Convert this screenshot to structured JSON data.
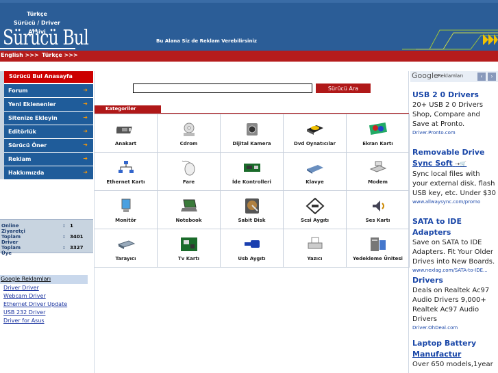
{
  "header": {
    "tagline": [
      "Türkçe",
      "Sürücü / Driver",
      "Arşivi"
    ],
    "logo": "Sürücü Bul",
    "ad_text": "Bu Alana Siz de Reklam Verebilirsiniz",
    "lang_english": "English >>>",
    "lang_turkish": "Türkçe >>>"
  },
  "sidebar": {
    "home": "Sürücü Bul Anasayfa",
    "items": [
      {
        "label": "Forum"
      },
      {
        "label": "Yeni Eklenenler"
      },
      {
        "label": "Sitenize Ekleyin"
      },
      {
        "label": "Editörlük"
      },
      {
        "label": "Sürücü Öner"
      },
      {
        "label": "Reklam"
      },
      {
        "label": "Hakkımızda"
      }
    ],
    "stats": [
      {
        "label": "Online Ziyaretçi",
        "value": "1"
      },
      {
        "label": "Toplam Driver",
        "value": "3401"
      },
      {
        "label": "Toplam Üye",
        "value": "3327"
      }
    ],
    "google_ads_title": "Google Reklamları",
    "google_ads": [
      "Driver Driver",
      "Webcam Driver",
      "Ethernet Driver Update",
      "USB 232 Driver",
      "Driver for Asus"
    ]
  },
  "search": {
    "value": "",
    "button": "Sürücü Ara"
  },
  "categories_title": "Kategoriler",
  "categories": [
    {
      "label": "Anakart",
      "icon": "motherboard-icon"
    },
    {
      "label": "Cdrom",
      "icon": "cdrom-icon"
    },
    {
      "label": "Dijital Kamera",
      "icon": "camera-icon"
    },
    {
      "label": "Dvd Oynatıcılar",
      "icon": "dvd-icon"
    },
    {
      "label": "Ekran Kartı",
      "icon": "graphics-card-icon"
    },
    {
      "label": "Ethernet Kartı",
      "icon": "network-icon"
    },
    {
      "label": "Fare",
      "icon": "mouse-icon"
    },
    {
      "label": "İde Kontrolleri",
      "icon": "ide-controller-icon"
    },
    {
      "label": "Klavye",
      "icon": "keyboard-icon"
    },
    {
      "label": "Modem",
      "icon": "modem-icon"
    },
    {
      "label": "Monitör",
      "icon": "monitor-icon"
    },
    {
      "label": "Notebook",
      "icon": "notebook-icon"
    },
    {
      "label": "Sabit Disk",
      "icon": "hard-disk-icon"
    },
    {
      "label": "Scsi Aygıtı",
      "icon": "scsi-icon"
    },
    {
      "label": "Ses Kartı",
      "icon": "sound-card-icon"
    },
    {
      "label": "Tarayıcı",
      "icon": "scanner-icon"
    },
    {
      "label": "Tv Kartı",
      "icon": "tv-card-icon"
    },
    {
      "label": "Usb Aygıtı",
      "icon": "usb-icon"
    },
    {
      "label": "Yazıcı",
      "icon": "printer-icon"
    },
    {
      "label": "Yedekleme Ünitesi",
      "icon": "backup-unit-icon"
    }
  ],
  "right_ads": {
    "brand": "Google",
    "label": "Reklamları",
    "ads": [
      {
        "title": "USB 2 0 Drivers",
        "title2": "",
        "desc": "20+ USB 2 0 Drivers Shop, Compare and Save at Pronto.",
        "url": "Driver.Pronto.com"
      },
      {
        "title": "Removable Drive",
        "title2": "Sync Soft",
        "desc": "Sync local files with your external disk, flash USB key, etc. Under $30",
        "url": "www.allwaysync.com/promo"
      },
      {
        "title": "SATA to IDE Adapters",
        "title2": "",
        "desc": "Save on SATA to IDE Adapters. Fit Your Older Drives into New Boards.",
        "url": "www.nexlag.com/SATA-to-IDE..."
      },
      {
        "title": "Drivers",
        "title2": "",
        "desc": "Deals on Realtek Ac97 Audio Drivers 9,000+ Realtek Ac97 Audio Drivers",
        "url": "Driver.OhDeal.com"
      },
      {
        "title": "Laptop Battery",
        "title2": "Manufactur",
        "desc": "Over 650 models,1year",
        "url": ""
      }
    ]
  },
  "colors": {
    "header_blue": "#2b5d97",
    "nav_blue": "#1f5c9a",
    "accent_red": "#b51c1c",
    "link_blue": "#1a47a8"
  }
}
